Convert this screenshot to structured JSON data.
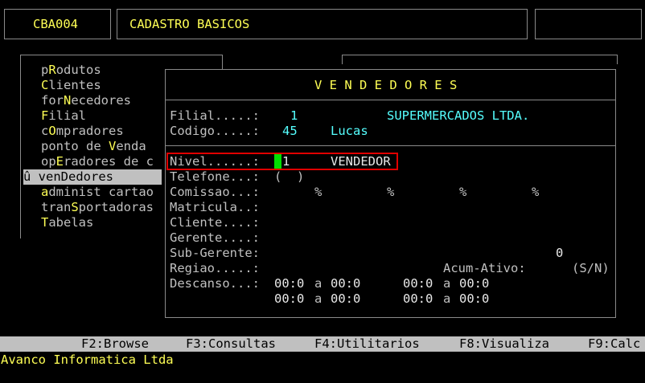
{
  "header": {
    "code": "CBA004",
    "title": "CADASTRO BASICOS"
  },
  "menu": {
    "items": [
      {
        "pre": "p",
        "hot": "R",
        "post": "odutos"
      },
      {
        "pre": "",
        "hot": "C",
        "post": "lientes"
      },
      {
        "pre": "for",
        "hot": "N",
        "post": "ecedores"
      },
      {
        "pre": "",
        "hot": "F",
        "post": "ilial"
      },
      {
        "pre": "c",
        "hot": "O",
        "post": "mpradores"
      },
      {
        "pre": "ponto de ",
        "hot": "V",
        "post": "enda"
      },
      {
        "pre": "op",
        "hot": "E",
        "post": "radores de c"
      },
      {
        "marker": "û ",
        "pre": "ven",
        "hot": "D",
        "post": "edores"
      },
      {
        "pre": "",
        "hot": "a",
        "post": "dminist cartao"
      },
      {
        "pre": "tran",
        "hot": "S",
        "post": "portadoras"
      },
      {
        "pre": "",
        "hot": "T",
        "post": "abelas"
      }
    ]
  },
  "form": {
    "title": "V E N D E D O R E S",
    "filial_label": "Filial.....:",
    "filial_value": "1",
    "filial_name": "SUPERMERCADOS LTDA.",
    "codigo_label": "Codigo.....:",
    "codigo_value": "45",
    "codigo_name": "Lucas",
    "nivel_label": "Nivel......:",
    "nivel_value": "1",
    "nivel_desc": "VENDEDOR",
    "telefone_label": "Telefone...:",
    "telefone_value": "(  )",
    "comissao_label": "Comissao...:",
    "comissao_values": [
      "%",
      "%",
      "%",
      "%"
    ],
    "matricula_label": "Matricula..:",
    "cliente_label": "Cliente....:",
    "gerente_label": "Gerente....:",
    "subgerente_label": "Sub-Gerente:",
    "subgerente_value": "0",
    "regiao_label": "Regiao.....:",
    "acum_label": "Acum-Ativo:",
    "acum_hint": "(S/N)",
    "descanso_label": "Descanso...:",
    "descanso_rows": [
      [
        "00:0",
        "a",
        "00:0",
        "00:0",
        "a",
        "00:0"
      ],
      [
        "00:0",
        "a",
        "00:0",
        "00:0",
        "a",
        "00:0"
      ]
    ]
  },
  "function_keys": [
    "F2:Browse",
    "F3:Consultas",
    "F4:Utilitarios",
    "F8:Visualiza",
    "F9:Calc"
  ],
  "footer": {
    "company": "Avanco Informatica Ltda"
  },
  "colors": {
    "highlight": "#ffff55",
    "value": "#55ffff",
    "cursor": "#00e000",
    "focus_border": "#e00000"
  }
}
